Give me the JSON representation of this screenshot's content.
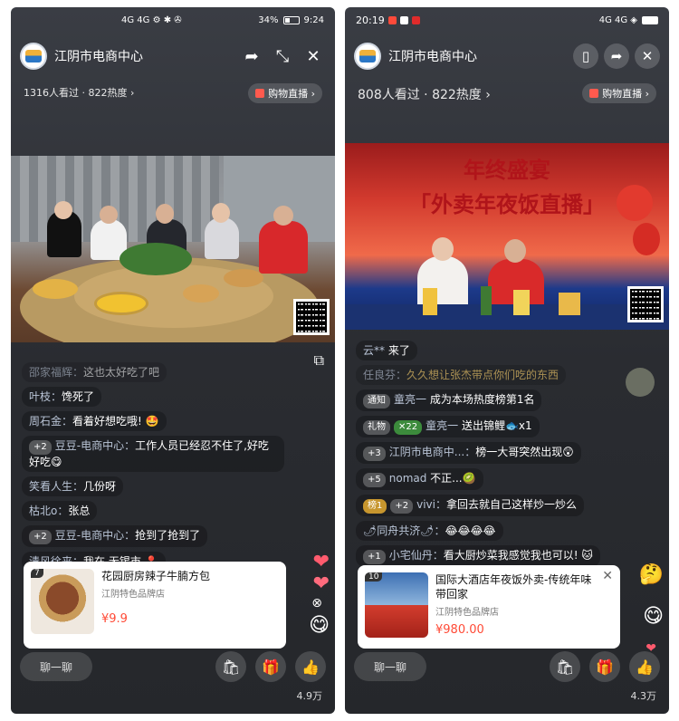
{
  "left": {
    "status": {
      "indicators": "4G 4G ⚙ ✱ ✇",
      "battery": "34%",
      "time": "9:24"
    },
    "shop_name": "江阴市电商中心",
    "stats": "1316人看过 · 822热度 ›",
    "shop_button": "购物直播 ›",
    "comments": [
      {
        "user": "邵家福辉：",
        "text": "这也太好吃了吧"
      },
      {
        "user": "叶枝：",
        "text": "馋死了"
      },
      {
        "user": "周石金：",
        "text": "看着好想吃哦! 🤩"
      },
      {
        "badge": "+2",
        "user": "豆豆-电商中心：",
        "text": "工作人员已经忍不住了,好吃好吃😋"
      },
      {
        "user": "笑看人生：",
        "text": "几份呀"
      },
      {
        "user": "枯北o：",
        "text": "张总"
      },
      {
        "badge": "+2",
        "user": "豆豆-电商中心：",
        "text": "抢到了抢到了"
      },
      {
        "user": "清风徐来：",
        "text": "我在 无锡市 📍"
      }
    ],
    "product": {
      "index": "7",
      "title": "花园厨房辣子牛腩方包",
      "shop": "江阴特色品牌店",
      "price": "¥9.9"
    },
    "chat_label": "聊一聊",
    "likes": "4.9万"
  },
  "right": {
    "status": {
      "time": "20:19",
      "indicators": "4G 4G ◈"
    },
    "shop_name": "江阴市电商中心",
    "stats": "808人看过 · 822热度 ›",
    "shop_button": "购物直播 ›",
    "banner_title": "年终盛宴",
    "banner_sub": "「外卖年夜饭直播」",
    "comments": [
      {
        "user": "云** ",
        "text": "来了"
      },
      {
        "user": "任良芬：",
        "text": "久久想让张杰带点你们吃的东西"
      },
      {
        "badge": "通知",
        "user": "童亮一 ",
        "text": "成为本场热度榜第1名"
      },
      {
        "badge": "礼物",
        "badge2": "✕22",
        "user": "童亮一 ",
        "text": "送出锦鲤🐟x1"
      },
      {
        "badge": "+3",
        "user": "江阴市电商中...：",
        "text": "榜一大哥突然出现😲"
      },
      {
        "badge": "+5",
        "user": "nomad ",
        "text": "不正...🥝"
      },
      {
        "badge": "榜1",
        "badge2": "+2",
        "user": "vivi：",
        "text": "拿回去就自己这样炒一炒么"
      },
      {
        "user": "🌶同舟共济🌶：",
        "text": "😂😂😂😂"
      },
      {
        "badge": "+1",
        "user": "小宅仙丹：",
        "text": "看大厨炒菜我感觉我也可以! 🐱"
      }
    ],
    "product": {
      "index": "10",
      "title": "国际大酒店年夜饭外卖-传统年味带回家",
      "shop": "江阴特色品牌店",
      "price": "¥980.00"
    },
    "chat_label": "聊一聊",
    "likes": "4.3万"
  }
}
